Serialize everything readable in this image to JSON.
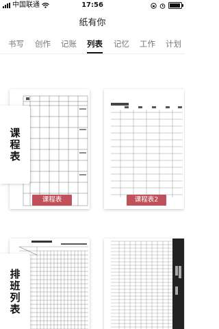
{
  "status": {
    "carrier": "中国联通",
    "time": "17:56"
  },
  "header": {
    "title": "纸有你"
  },
  "tabs": [
    {
      "label": "书写"
    },
    {
      "label": "创作"
    },
    {
      "label": "记账"
    },
    {
      "label": "列表",
      "active": true
    },
    {
      "label": "记忆"
    },
    {
      "label": "工作"
    },
    {
      "label": "计划"
    }
  ],
  "categories": [
    {
      "label": "课程表",
      "chars": [
        "课",
        "程",
        "表"
      ]
    },
    {
      "label": "排班列表",
      "chars": [
        "排",
        "班",
        "列",
        "表"
      ]
    }
  ],
  "cards": {
    "course1": {
      "button": "课程表"
    },
    "course2": {
      "button": "课程表2"
    }
  },
  "colors": {
    "accent": "#c0505a"
  }
}
